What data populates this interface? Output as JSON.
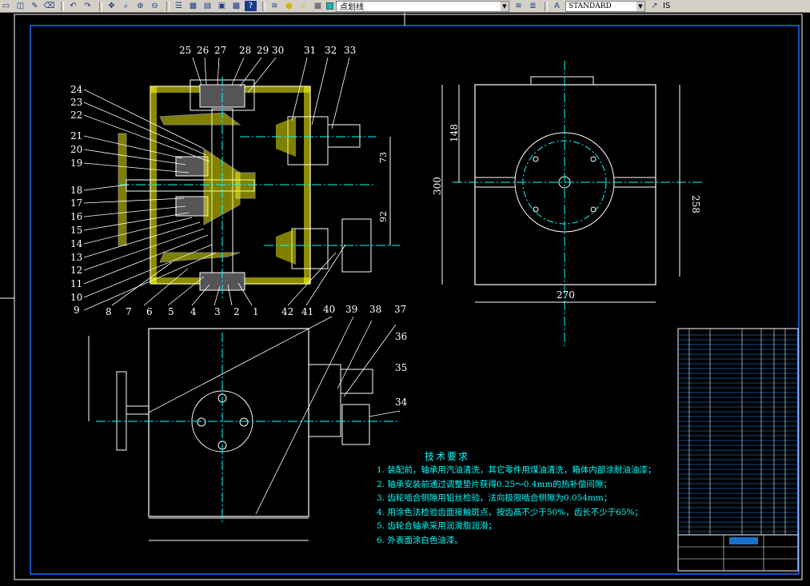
{
  "toolbar": {
    "layer_name": "点划线",
    "text_style": "STANDARD",
    "tail_label": "IS",
    "icons": [
      "new-icon",
      "open-icon",
      "pencil-icon",
      "eraser-icon",
      "undo-icon",
      "redo-icon",
      "pan-icon",
      "zoom-realtime-icon",
      "zoom-window-icon",
      "zoom-previous-icon",
      "properties-icon",
      "design-center-icon",
      "tool-palette-icon",
      "markup-icon",
      "calculator-icon",
      "help-icon",
      "layer-manager-icon",
      "bulb-icon",
      "sun-icon",
      "lock-icon",
      "color-swatch-icon",
      "layer-prev-icon",
      "layer-state-icon",
      "text-style-icon",
      "dimension-style-icon"
    ]
  },
  "drawing": {
    "part_numbers_top": [
      "25",
      "26",
      "27",
      "28",
      "29",
      "30",
      "31",
      "32",
      "33"
    ],
    "part_numbers_left": [
      "24",
      "23",
      "22",
      "21",
      "20",
      "19",
      "18",
      "17",
      "16",
      "15",
      "14",
      "13",
      "12",
      "11",
      "10",
      "9"
    ],
    "part_numbers_bottom": [
      "8",
      "7",
      "6",
      "5",
      "4",
      "3",
      "2",
      "1",
      "42",
      "41",
      "40",
      "39",
      "38",
      "37"
    ],
    "part_numbers_right": [
      "36",
      "35",
      "34"
    ],
    "dimensions": {
      "d73": "73",
      "d92": "92",
      "d148": "148",
      "d300": "300",
      "d258": "258",
      "d270": "270"
    }
  },
  "tech_requirements": {
    "title": "技术要求",
    "lines": [
      "1. 装配前，轴承用汽油清洗，其它零件用煤油清洗，箱体内部涂耐油油漆；",
      "2. 轴承安装前通过调整垫片获得0.25～0.4mm的热补偿间隙；",
      "3. 齿轮啮合侧隙用铅丝检验，法向极限啮合侧隙为0.054mm；",
      "4. 用涂色法检验齿面接触斑点，按齿高不少于50%，齿长不少于65%；",
      "5. 齿轮合轴承采用润滑脂润滑；",
      "6. 外表面涂白色油漆。"
    ]
  },
  "colors": {
    "background": "#000000",
    "outline": "#ffffff",
    "centerline": "#00ffff",
    "section": "#ffff00",
    "accent": "#ff00ff",
    "title_block": "#1e90ff"
  }
}
